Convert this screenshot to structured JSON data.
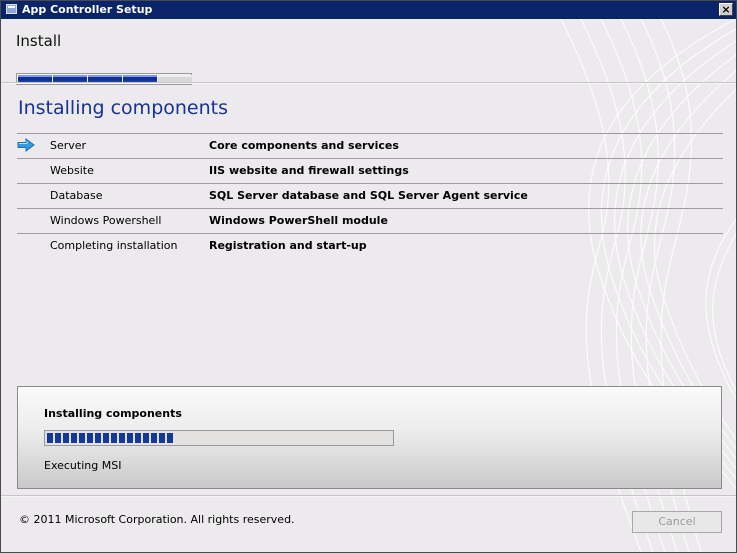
{
  "window": {
    "title": "App Controller Setup",
    "close_glyph": "×",
    "title_icon": "setup-window-icon"
  },
  "header": {
    "title": "Install",
    "step_progress": {
      "completed": 4,
      "total": 5
    }
  },
  "main": {
    "section_title": "Installing components",
    "components": [
      {
        "name": "Server",
        "description": "Core components and services",
        "current": true,
        "icon": "arrow-right-icon"
      },
      {
        "name": "Website",
        "description": "IIS website and firewall settings",
        "current": false
      },
      {
        "name": "Database",
        "description": "SQL Server database and SQL Server Agent service",
        "current": false
      },
      {
        "name": "Windows Powershell",
        "description": "Windows PowerShell module",
        "current": false
      },
      {
        "name": "Completing installation",
        "description": "Registration and start-up",
        "current": false
      }
    ]
  },
  "status": {
    "title": "Installing components",
    "progress": 0.37,
    "message": "Executing MSI"
  },
  "footer": {
    "copyright": "© 2011 Microsoft Corporation. All rights reserved.",
    "cancel_label": "Cancel",
    "cancel_enabled": false
  },
  "colors": {
    "title_bar": "#0a246a",
    "accent": "#16329c",
    "progress": "#123a9e",
    "arrow": "#2f9be0"
  }
}
